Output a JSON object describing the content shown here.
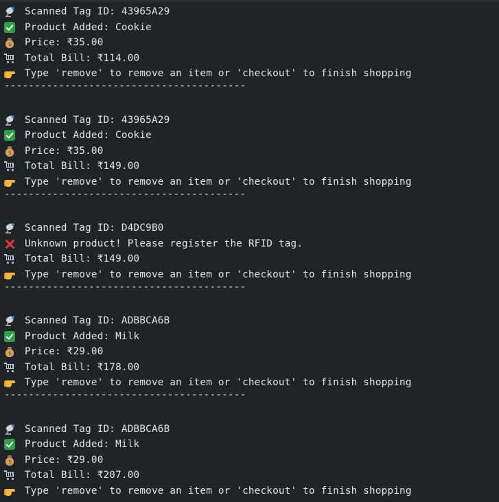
{
  "terminal": {
    "blocks": [
      {
        "scanned": "Scanned Tag ID: 43965A29",
        "added": "Product Added: Cookie",
        "price": "Price: ₹35.00",
        "total": "Total Bill: ₹114.00",
        "prompt": "Type 'remove' to remove an item or 'checkout' to finish shopping",
        "divider": "----------------------------------------"
      },
      {
        "scanned": "Scanned Tag ID: 43965A29",
        "added": "Product Added: Cookie",
        "price": "Price: ₹35.00",
        "total": "Total Bill: ₹149.00",
        "prompt": "Type 'remove' to remove an item or 'checkout' to finish shopping",
        "divider": "----------------------------------------"
      },
      {
        "scanned": "Scanned Tag ID: D4DC9B0",
        "error": "Unknown product! Please register the RFID tag.",
        "total": "Total Bill: ₹149.00",
        "prompt": "Type 'remove' to remove an item or 'checkout' to finish shopping",
        "divider": "----------------------------------------"
      },
      {
        "scanned": "Scanned Tag ID: ADBBCA6B",
        "added": "Product Added: Milk",
        "price": "Price: ₹29.00",
        "total": "Total Bill: ₹178.00",
        "prompt": "Type 'remove' to remove an item or 'checkout' to finish shopping",
        "divider": "----------------------------------------"
      },
      {
        "scanned": "Scanned Tag ID: ADBBCA6B",
        "added": "Product Added: Milk",
        "price": "Price: ₹29.00",
        "total": "Total Bill: ₹207.00",
        "prompt": "Type 'remove' to remove an item or 'checkout' to finish shopping"
      }
    ],
    "icons": {
      "scanned": "satellite-antenna-icon",
      "added": "check-mark-icon",
      "error": "cross-mark-icon",
      "price": "money-bag-icon",
      "total": "shopping-cart-icon",
      "prompt": "pointing-hand-icon"
    },
    "colors": {
      "background": "#1f2428",
      "text": "#e6e6e6",
      "check": "#2ea043",
      "cross": "#e5333b"
    }
  }
}
